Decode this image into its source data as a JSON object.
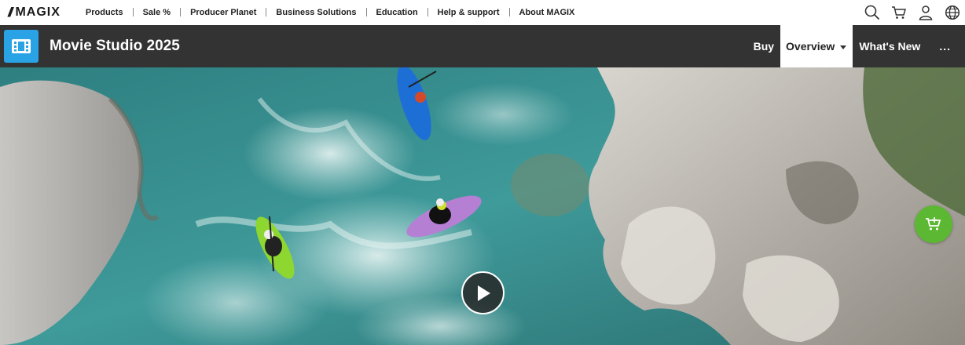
{
  "header": {
    "brand": "MAGIX",
    "nav": [
      {
        "label": "Products"
      },
      {
        "label": "Sale %"
      },
      {
        "label": "Producer Planet"
      },
      {
        "label": "Business Solutions"
      },
      {
        "label": "Education"
      },
      {
        "label": "Help & support"
      },
      {
        "label": "About MAGIX"
      }
    ],
    "icons": [
      "search-icon",
      "cart-icon",
      "user-icon",
      "globe-icon"
    ]
  },
  "product": {
    "title": "Movie Studio 2025",
    "nav": {
      "buy": "Buy",
      "overview": "Overview",
      "whats_new": "What's New",
      "more": "..."
    }
  },
  "hero": {
    "description_icons": [
      "play-icon",
      "cart-add-icon"
    ]
  },
  "colors": {
    "product_bar": "#333333",
    "product_logo": "#2aa3e6",
    "cart_fab": "#5cb832",
    "water": "#3f8f8f"
  }
}
